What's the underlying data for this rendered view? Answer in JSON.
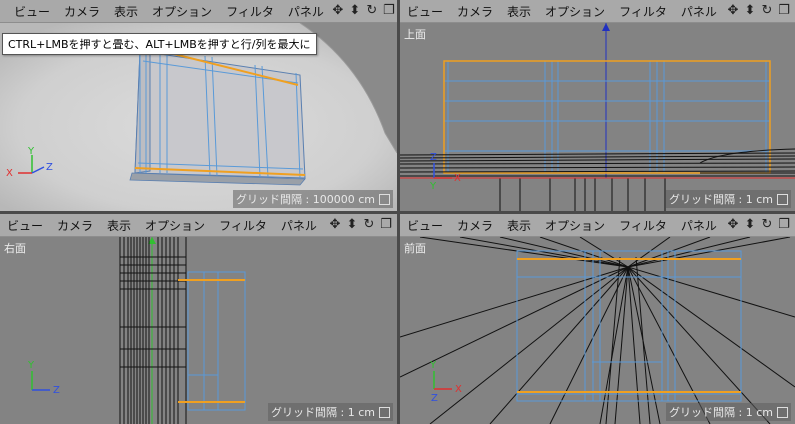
{
  "menu": [
    "ビュー",
    "カメラ",
    "表示",
    "オプション",
    "フィルタ",
    "パネル"
  ],
  "nav_icons": [
    "move-view-icon",
    "zoom-view-icon",
    "rotate-view-icon",
    "toggle-layout-icon"
  ],
  "nav_glyphs": [
    "✥",
    "⬍",
    "↻",
    "❐"
  ],
  "tooltip": "CTRL+LMBを押すと畳む、ALT+LMBを押すと行/列を最大に",
  "viewports": {
    "perspective": {
      "name": "",
      "grid": "グリッド間隔 : 100000 cm"
    },
    "top": {
      "name": "上面",
      "grid": "グリッド間隔 : 1 cm"
    },
    "right": {
      "name": "右面",
      "grid": "グリッド間隔 : 1 cm"
    },
    "front": {
      "name": "前面",
      "grid": "グリッド間隔 : 1 cm"
    }
  },
  "axes": {
    "x": "X",
    "y": "Y",
    "z": "Z"
  },
  "colors": {
    "x_axis": "#e03030",
    "y_axis": "#30c030",
    "z_axis": "#3050e0",
    "selection": "#f0a020",
    "wire": "#5a9ad8"
  }
}
